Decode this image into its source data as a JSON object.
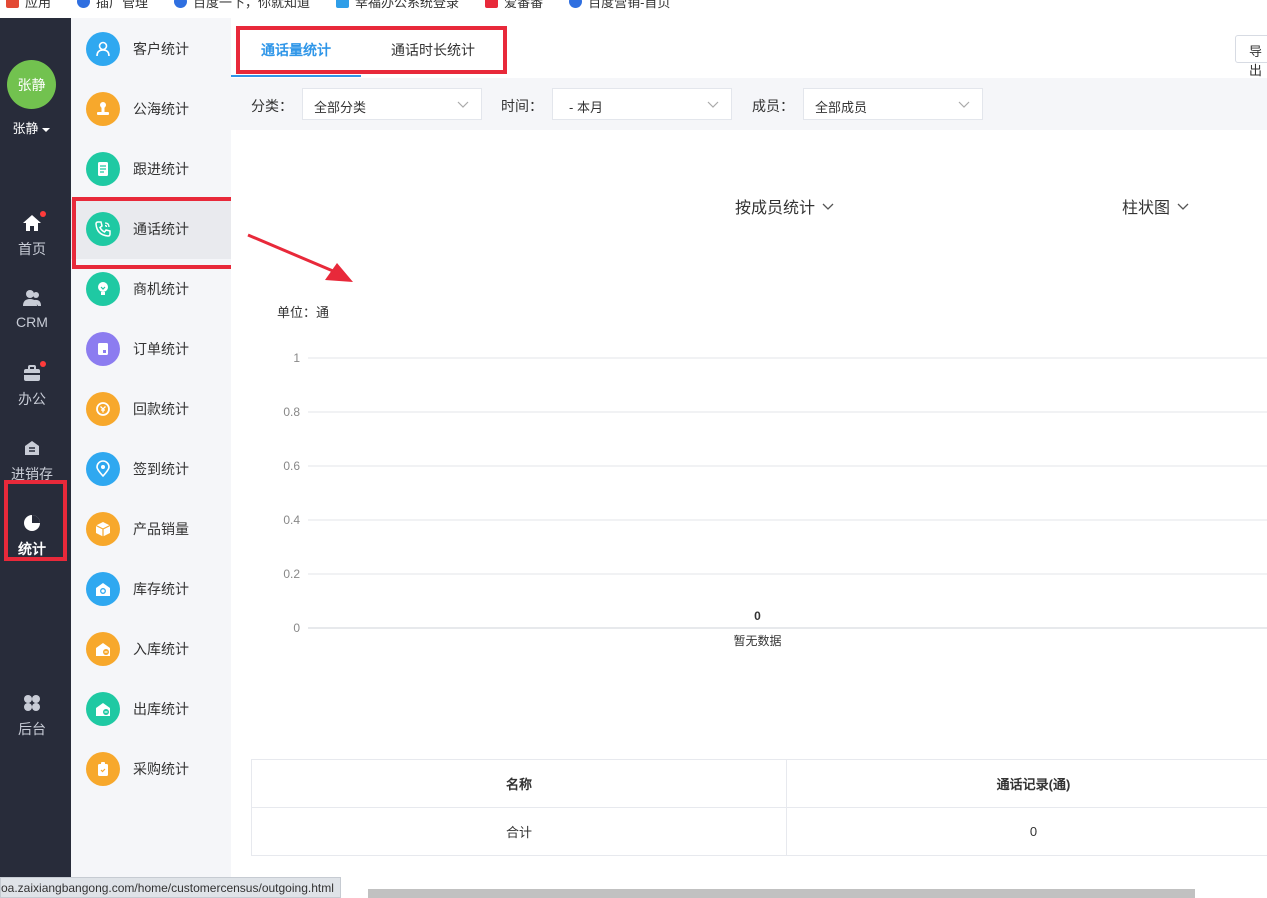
{
  "bookmarks": [
    {
      "label": "应用",
      "icon": "apps-grid-icon",
      "color": "#e34a35"
    },
    {
      "label": "插广管理",
      "icon": "baidu-paw-icon",
      "color": "#2f6fe0"
    },
    {
      "label": "百度一下，你就知道",
      "icon": "baidu-paw-icon",
      "color": "#2f6fe0"
    },
    {
      "label": "幸福办公系统登录",
      "icon": "app-icon",
      "color": "#2f9ee8"
    },
    {
      "label": "爱番番",
      "icon": "app-icon",
      "color": "#e8293a"
    },
    {
      "label": "百度营销-首页",
      "icon": "baidu-paw-icon",
      "color": "#2f6fe0"
    }
  ],
  "user": {
    "avatar_text": "张静",
    "name": "张静"
  },
  "rail": [
    {
      "label": "首页",
      "icon": "home-icon",
      "dot": true
    },
    {
      "label": "CRM",
      "icon": "users-icon",
      "dot": false
    },
    {
      "label": "办公",
      "icon": "briefcase-icon",
      "dot": true
    },
    {
      "label": "进销存",
      "icon": "inventory-icon",
      "dot": false
    },
    {
      "label": "统计",
      "icon": "pie-chart-icon",
      "dot": false,
      "active": true
    },
    {
      "label": "后台",
      "icon": "grid-icon",
      "dot": false
    }
  ],
  "submenu": [
    {
      "label": "客户统计",
      "icon": "customer-icon",
      "color": "#2fa8f0"
    },
    {
      "label": "公海统计",
      "icon": "seal-icon",
      "color": "#f7a82c"
    },
    {
      "label": "跟进统计",
      "icon": "document-icon",
      "color": "#1fc9a3"
    },
    {
      "label": "通话统计",
      "icon": "phone-icon",
      "color": "#1fc9a3",
      "active": true
    },
    {
      "label": "商机统计",
      "icon": "lightbulb-icon",
      "color": "#1fc9a3"
    },
    {
      "label": "订单统计",
      "icon": "order-icon",
      "color": "#8c7cf0"
    },
    {
      "label": "回款统计",
      "icon": "refund-icon",
      "color": "#f7a82c"
    },
    {
      "label": "签到统计",
      "icon": "location-pin-icon",
      "color": "#2fa8f0"
    },
    {
      "label": "产品销量",
      "icon": "box-icon",
      "color": "#f7a82c"
    },
    {
      "label": "库存统计",
      "icon": "warehouse-icon",
      "color": "#2fa8f0"
    },
    {
      "label": "入库统计",
      "icon": "stock-in-icon",
      "color": "#f7a82c"
    },
    {
      "label": "出库统计",
      "icon": "stock-out-icon",
      "color": "#1fc9a3"
    },
    {
      "label": "采购统计",
      "icon": "purchase-icon",
      "color": "#f7a82c"
    }
  ],
  "tabs": [
    {
      "label": "通话量统计",
      "active": true
    },
    {
      "label": "通话时长统计",
      "active": false
    }
  ],
  "export_label": "导出",
  "filters": {
    "category_label": "分类：",
    "category_value": "全部分类",
    "time_label": "时间：",
    "time_value": "- 本月",
    "member_label": "成员：",
    "member_value": "全部成员"
  },
  "chart_controls": {
    "group_by": "按成员统计",
    "chart_type": "柱状图"
  },
  "chart_data": {
    "type": "bar",
    "unit_label": "单位：通",
    "yticks": [
      0,
      0.2,
      0.4,
      0.6,
      0.8,
      1
    ],
    "ylim": [
      0,
      1
    ],
    "categories": [
      "暂无数据"
    ],
    "values": [
      0
    ],
    "grid": true
  },
  "table": {
    "headers": [
      "名称",
      "通话记录(通)"
    ],
    "rows": [
      [
        "合计",
        "0"
      ]
    ]
  },
  "status_url": "oa.zaixiangbangong.com/home/customercensus/outgoing.html",
  "colors": {
    "accent": "#2f96e8",
    "highlight": "#e8293a",
    "rail_bg": "#282c3a"
  }
}
